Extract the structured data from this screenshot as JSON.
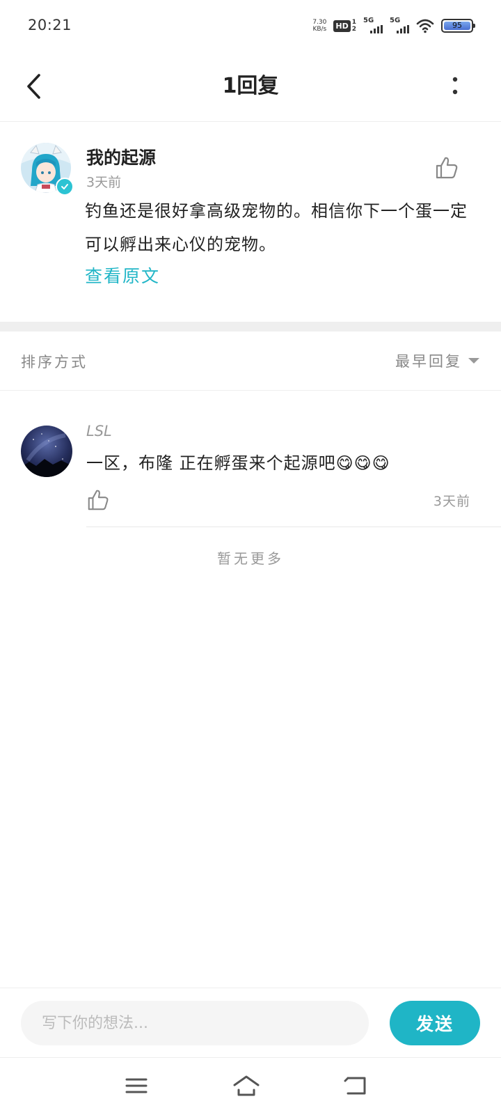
{
  "status_bar": {
    "time": "20:21",
    "net_speed_value": "7.30",
    "net_speed_unit": "KB/s",
    "hd_label": "HD",
    "hd_sim_top": "1",
    "hd_sim_bottom": "2",
    "signal_1_label": "5G",
    "signal_2_label": "5G",
    "battery": "95",
    "icons": [
      "hd-icon",
      "signal-icon",
      "signal-icon",
      "wifi-icon",
      "battery-icon"
    ]
  },
  "header": {
    "title": "1回复",
    "back_icon": "chevron-left-icon",
    "more_icon": "more-vertical-icon"
  },
  "post": {
    "author": "我的起源",
    "time": "3天前",
    "content": "钓鱼还是很好拿高级宠物的。相信你下一个蛋一定可以孵出来心仪的宠物。",
    "view_original": "查看原文",
    "like_icon": "thumbs-up-icon",
    "verified_icon": "verified-check-icon"
  },
  "sort": {
    "label": "排序方式",
    "value": "最早回复",
    "icon": "caret-down-icon"
  },
  "replies": [
    {
      "author": "LSL",
      "content": "一区，布隆 正在孵蛋来个起源吧😋😋😋",
      "time": "3天前",
      "like_icon": "thumbs-up-icon"
    }
  ],
  "no_more": "暂无更多",
  "input_bar": {
    "placeholder": "写下你的想法...",
    "send_label": "发送"
  },
  "nav_bar": {
    "icons": [
      "menu-icon",
      "home-icon",
      "back-arrow-icon"
    ]
  },
  "colors": {
    "accent": "#1fb5c6",
    "link": "#22b6c7",
    "divider": "#efefef"
  }
}
